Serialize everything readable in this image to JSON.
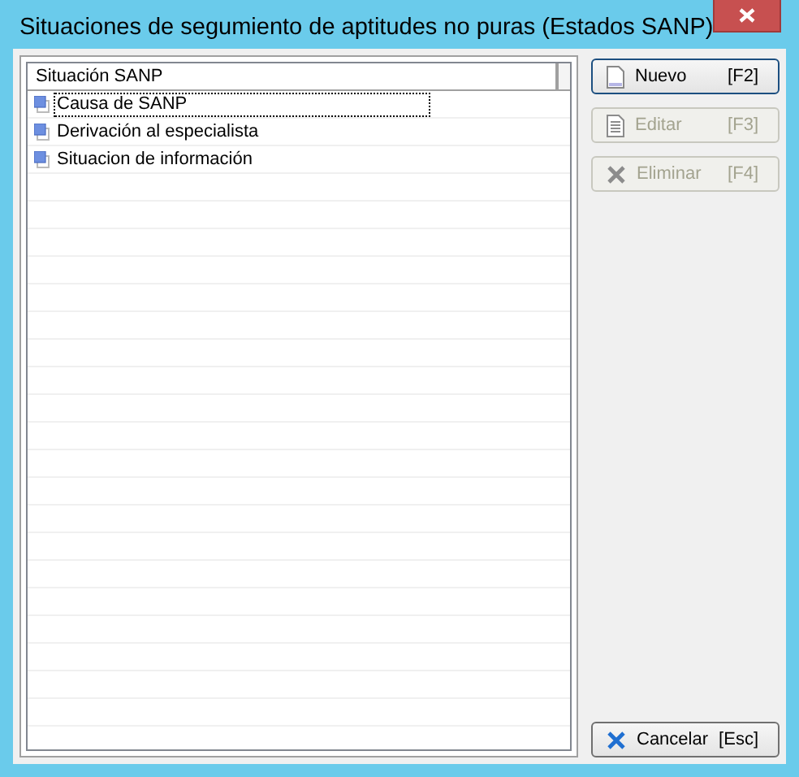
{
  "window": {
    "title": "Situaciones de segumiento de aptitudes no puras (Estados SANP)"
  },
  "table": {
    "columns": [
      "Situación SANP"
    ],
    "rows": [
      {
        "label": "Causa de SANP",
        "selected": true
      },
      {
        "label": "Derivación al especialista",
        "selected": false
      },
      {
        "label": "Situacion de información",
        "selected": false
      }
    ]
  },
  "buttons": [
    {
      "kind": "new",
      "label": "Nuevo",
      "shortcut": "[F2]",
      "disabled": false,
      "focused": true
    },
    {
      "kind": "edit",
      "label": "Editar",
      "shortcut": "[F3]",
      "disabled": true,
      "focused": false
    },
    {
      "kind": "delete",
      "label": "Eliminar",
      "shortcut": "[F4]",
      "disabled": true,
      "focused": false
    }
  ],
  "cancel_button": {
    "kind": "cancel",
    "label": "Cancelar",
    "shortcut": "[Esc]",
    "disabled": false,
    "focused": false
  }
}
